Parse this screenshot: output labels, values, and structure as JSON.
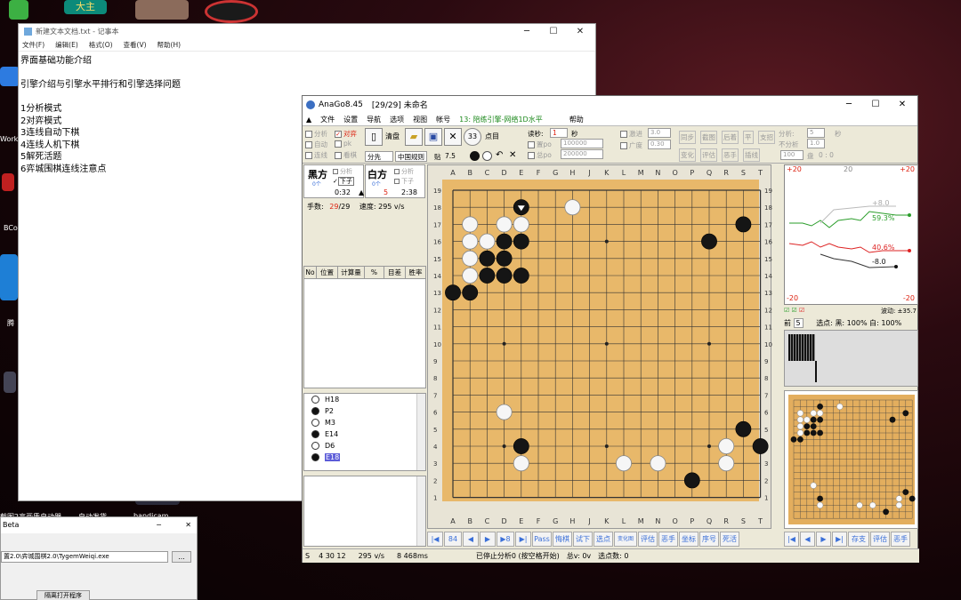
{
  "desktop": {
    "label_daguan": "大主",
    "label_work": "Work",
    "label_bc": "BCo",
    "label_teng": "腾",
    "label_autoshot": "自动发货",
    "label_bandicam": "bandicam",
    "label_maker": "截图2高画质自动器"
  },
  "notepad": {
    "title": "新建文本文档.txt - 记事本",
    "menu": [
      "文件(F)",
      "编辑(E)",
      "格式(O)",
      "查看(V)",
      "帮助(H)"
    ],
    "lines": [
      "界面基础功能介绍",
      "",
      "引擎介绍与引擎水平排行和引擎选择问题",
      "",
      "1分析模式",
      "2对弈模式",
      "3连线自动下棋",
      "4连线人机下棋",
      "5解死活题",
      "6弈城围棋连线注意点"
    ]
  },
  "dialog": {
    "title": "Beta",
    "path": "置2.0\\弈城围棋2.0\\TygemWeiqi.exe",
    "browse": "...",
    "open_button": "隔离打开程序"
  },
  "anago": {
    "title": "AnaGo8.45",
    "title_info": "[29/29] 未命名",
    "menu": [
      "文件",
      "设置",
      "导航",
      "选项",
      "视图",
      "帐号"
    ],
    "engine_label": "13: 陪练引擎-网络1D水平",
    "help": "帮助",
    "toolbar": {
      "analyze": "分析",
      "auto": "自动",
      "connect": "连线",
      "vs": "对弈",
      "pk": "pk",
      "watch": "看棋",
      "clear": "清盘",
      "dianmu": "点目",
      "readsec_label": "读秒:",
      "readsec": "1",
      "sec": "秒",
      "po1": "置po",
      "po1_val": "100000",
      "po2": "总po",
      "po2_val": "200000",
      "rules_mode": "分先",
      "rules": "中国规则",
      "komi_label": "贴",
      "komi": "7.5",
      "jiji": "激进",
      "jiji_val": "3.0",
      "guangdu": "广度",
      "guangdu_val": "0.30",
      "tongbu": "同步",
      "jietu": "截图",
      "houzhao": "后着",
      "pinggu": "评估",
      "sishou": "恶手",
      "bianhua": "变化",
      "zhibo": "支招",
      "chaxian": "插线",
      "fenxi": "分析:",
      "budeifen": "不分析",
      "pan": "盘",
      "n5": "5",
      "n10": "1.0",
      "n100": "100",
      "score": "0 : 0",
      "miao": "秒",
      "ping": "平"
    },
    "players": {
      "black": "黑方",
      "white": "白方",
      "black_count": "0个",
      "white_count": "0个",
      "fenxi": "分析",
      "xiazi": "下子",
      "black_time": "0:32",
      "move_mark": "5",
      "white_time": "2:38"
    },
    "moves_label": "手数:",
    "moves_cur": "29",
    "moves_total": "/29",
    "speed_label": "速度:",
    "speed": "295 v/s",
    "table_headers": [
      "No",
      "位置",
      "计算量",
      "%",
      "目差",
      "胜率"
    ],
    "move_list": [
      {
        "color": "white",
        "move": "H18"
      },
      {
        "color": "black",
        "move": "P2"
      },
      {
        "color": "white",
        "move": "M3"
      },
      {
        "color": "black",
        "move": "E14"
      },
      {
        "color": "white",
        "move": "D6"
      },
      {
        "color": "black",
        "move": "E18"
      }
    ],
    "board": {
      "cols": [
        "A",
        "B",
        "C",
        "D",
        "E",
        "F",
        "G",
        "H",
        "J",
        "K",
        "L",
        "M",
        "N",
        "O",
        "P",
        "Q",
        "R",
        "S",
        "T"
      ],
      "rows": [
        "19",
        "18",
        "17",
        "16",
        "15",
        "14",
        "13",
        "12",
        "11",
        "10",
        "9",
        "8",
        "7",
        "6",
        "5",
        "4",
        "3",
        "2",
        "1"
      ],
      "black": [
        "E18",
        "S17",
        "D16",
        "E16",
        "Q16",
        "C15",
        "D15",
        "C14",
        "D14",
        "E14",
        "A13",
        "B13",
        "S5",
        "E4",
        "T4",
        "P2"
      ],
      "white": [
        "H18",
        "B17",
        "D17",
        "E17",
        "B16",
        "C16",
        "B15",
        "B14",
        "D6",
        "R4",
        "E3",
        "L3",
        "N3",
        "R3"
      ],
      "last": "E18"
    },
    "graph": {
      "top_left": "+20",
      "top_mid": "20",
      "top_right": "+20",
      "bot_left": "-20",
      "bot_right": "-20",
      "v1": "+8.0",
      "v2": "59.3%",
      "v3": "40.6%",
      "v4": "-8.0",
      "bodong": "波动: ±35.7"
    },
    "winrate": {
      "qian": "前",
      "qian_val": "5",
      "pick": "选点:",
      "black": "黑: 100%",
      "white": "白: 100%"
    },
    "bottom_buttons": [
      "84",
      "Pass",
      "悔棋",
      "试下",
      "选点",
      "变化图",
      "评估",
      "恶手",
      "坐标",
      "序号",
      "死活"
    ],
    "right_buttons": [
      "存支",
      "评估",
      "恶手"
    ],
    "status": {
      "s": "S",
      "nums": "4  30  12",
      "speed": "295 v/s",
      "ms": "8  468ms",
      "msg": "已停止分析0 (按空格开始)",
      "total": "总v: 0v",
      "pick": "选点数: 0"
    }
  }
}
